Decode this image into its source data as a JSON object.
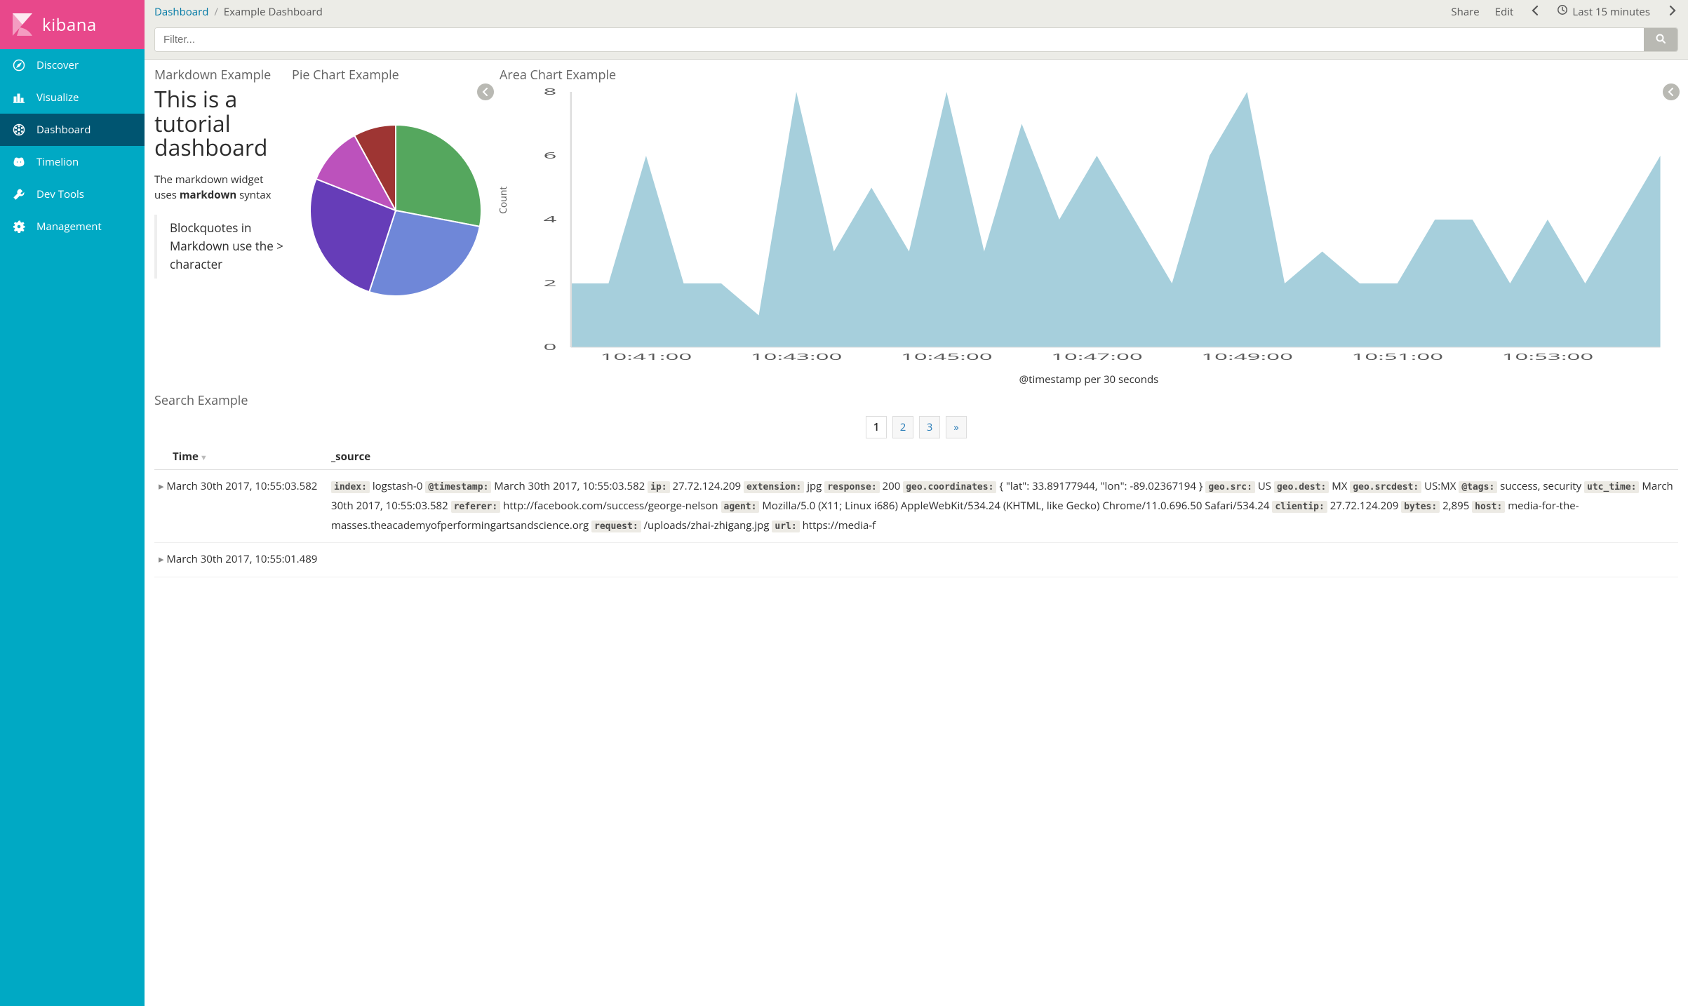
{
  "brand": "kibana",
  "sidebar": {
    "items": [
      {
        "label": "Discover",
        "icon": "compass-icon"
      },
      {
        "label": "Visualize",
        "icon": "bar-chart-icon"
      },
      {
        "label": "Dashboard",
        "icon": "dashboard-icon"
      },
      {
        "label": "Timelion",
        "icon": "bear-icon"
      },
      {
        "label": "Dev Tools",
        "icon": "wrench-icon"
      },
      {
        "label": "Management",
        "icon": "gear-icon"
      }
    ],
    "active_index": 2
  },
  "breadcrumb": {
    "root": "Dashboard",
    "sep": "/",
    "current": "Example Dashboard"
  },
  "toolbar": {
    "share": "Share",
    "edit": "Edit",
    "time_label": "Last 15 minutes"
  },
  "filter": {
    "placeholder": "Filter..."
  },
  "panels": {
    "markdown_title": "Markdown Example",
    "pie_title": "Pie Chart Example",
    "area_title": "Area Chart Example",
    "search_title": "Search Example",
    "markdown": {
      "heading": "This is a tutorial dashboard",
      "p1a": "The markdown widget uses ",
      "p1b": "markdown",
      "p1c": " syntax",
      "blockquote": "Blockquotes in Markdown use the > character"
    }
  },
  "chart_data": [
    {
      "type": "pie",
      "slices": [
        {
          "label": "green",
          "value": 28,
          "color": "#55a75e"
        },
        {
          "label": "blue",
          "value": 27,
          "color": "#6f87d8"
        },
        {
          "label": "purple",
          "value": 26,
          "color": "#663db8"
        },
        {
          "label": "magenta",
          "value": 11,
          "color": "#bc52bc"
        },
        {
          "label": "darkred",
          "value": 8,
          "color": "#9e3533"
        }
      ]
    },
    {
      "type": "area",
      "title": "",
      "ylabel": "Count",
      "xlabel": "@timestamp per 30 seconds",
      "ylim": [
        0,
        8
      ],
      "yticks": [
        0,
        2,
        4,
        6,
        8
      ],
      "xticks": [
        "10:41:00",
        "10:43:00",
        "10:45:00",
        "10:47:00",
        "10:49:00",
        "10:51:00",
        "10:53:00"
      ],
      "series": [
        {
          "name": "Count",
          "color": "#a6cfdc",
          "x": [
            "10:40:00",
            "10:40:30",
            "10:41:00",
            "10:41:30",
            "10:42:00",
            "10:42:30",
            "10:43:00",
            "10:43:30",
            "10:44:00",
            "10:44:30",
            "10:45:00",
            "10:45:30",
            "10:46:00",
            "10:46:30",
            "10:47:00",
            "10:47:30",
            "10:48:00",
            "10:48:30",
            "10:49:00",
            "10:49:30",
            "10:50:00",
            "10:50:30",
            "10:51:00",
            "10:51:30",
            "10:52:00",
            "10:52:30",
            "10:53:00",
            "10:53:30",
            "10:54:00",
            "10:54:30"
          ],
          "values": [
            2,
            2,
            6,
            2,
            2,
            1,
            8,
            3,
            5,
            3,
            8,
            3,
            7,
            4,
            6,
            4,
            2,
            6,
            8,
            2,
            3,
            2,
            2,
            4,
            4,
            2,
            4,
            2,
            4,
            6
          ]
        }
      ]
    }
  ],
  "table": {
    "columns": {
      "time": "Time",
      "source": "_source"
    },
    "pager": [
      "1",
      "2",
      "3",
      "»"
    ],
    "active_page": 0,
    "rows": [
      {
        "time": "March 30th 2017, 10:55:03.582",
        "fields": [
          {
            "k": "index:",
            "v": "logstash-0"
          },
          {
            "k": "@timestamp:",
            "v": "March 30th 2017, 10:55:03.582"
          },
          {
            "k": "ip:",
            "v": "27.72.124.209"
          },
          {
            "k": "extension:",
            "v": "jpg"
          },
          {
            "k": "response:",
            "v": "200"
          },
          {
            "k": "geo.coordinates:",
            "v": "{ \"lat\": 33.89177944, \"lon\": -89.02367194 }"
          },
          {
            "k": "geo.src:",
            "v": "US"
          },
          {
            "k": "geo.dest:",
            "v": "MX"
          },
          {
            "k": "geo.srcdest:",
            "v": "US:MX"
          },
          {
            "k": "@tags:",
            "v": "success, security"
          },
          {
            "k": "utc_time:",
            "v": "March 30th 2017, 10:55:03.582"
          },
          {
            "k": "referer:",
            "v": "http://facebook.com/success/george-nelson"
          },
          {
            "k": "agent:",
            "v": "Mozilla/5.0 (X11; Linux i686) AppleWebKit/534.24 (KHTML, like Gecko) Chrome/11.0.696.50 Safari/534.24"
          },
          {
            "k": "clientip:",
            "v": "27.72.124.209"
          },
          {
            "k": "bytes:",
            "v": "2,895"
          },
          {
            "k": "host:",
            "v": "media-for-the-masses.theacademyofperformingartsandscience.org"
          },
          {
            "k": "request:",
            "v": "/uploads/zhai-zhigang.jpg"
          },
          {
            "k": "url:",
            "v": "https://media-f"
          }
        ]
      },
      {
        "time": "March 30th 2017, 10:55:01.489",
        "fields": []
      }
    ]
  }
}
